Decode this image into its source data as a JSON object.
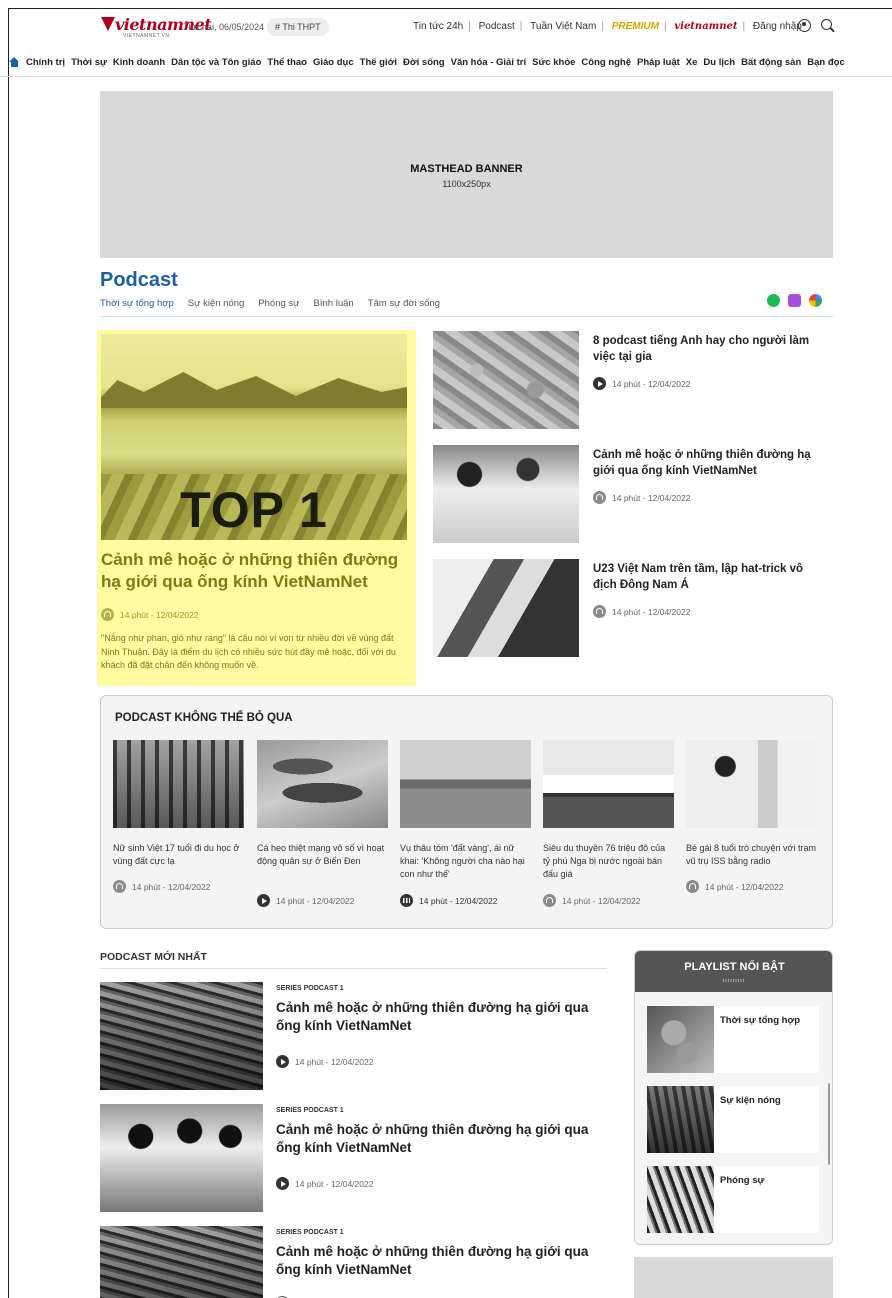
{
  "header": {
    "logo_text": "vietnamnet",
    "logo_sub": "VIETNAMNET.VN",
    "date": "Thứ hai, 06/05/2024",
    "hashtag": "# Thi THPT",
    "links": [
      "Tin tức 24h",
      "Podcast",
      "Tuần Việt Nam"
    ],
    "premium": "PREMIUM",
    "global_logo": "vietnamnet",
    "login": "Đăng nhập",
    "icons": [
      "user-icon",
      "search-icon"
    ]
  },
  "nav": {
    "home_icon": "home-icon",
    "items": [
      "Chính trị",
      "Thời sự",
      "Kinh doanh",
      "Dân tộc và Tôn giáo",
      "Thể thao",
      "Giáo dục",
      "Thế giới",
      "Đời sống",
      "Văn hóa - Giải trí",
      "Sức khỏe",
      "Công nghệ",
      "Pháp luật",
      "Xe",
      "Du lịch",
      "Bất động sản",
      "Bạn đọc"
    ]
  },
  "banner": {
    "title": "MASTHEAD BANNER",
    "size": "1100x250px"
  },
  "podcast": {
    "title": "Podcast",
    "tabs": [
      "Thời sự tổng hợp",
      "Sự kiện nóng",
      "Phóng sự",
      "Bình luận",
      "Tâm sự đời sống"
    ],
    "platforms": [
      "spotify-icon",
      "apple-podcasts-icon",
      "google-podcasts-icon"
    ]
  },
  "featured": {
    "badge": "TOP 1",
    "title": "Cảnh mê hoặc ở những thiên đường hạ giới qua ống kính VietNamNet",
    "meta": "14 phút - 12/04/2022",
    "description": "\"Nắng như phan, gió như rang\" là câu nói ví von từ nhiều đời về vùng đất Ninh Thuận. Đây là điểm du lịch có nhiều sức hút đầy mê hoặc, đối với du khách đã đặt chân đến không muốn về."
  },
  "side_items": [
    {
      "title": "8 podcast tiếng Anh hay cho người làm việc tại gia",
      "meta": "14 phút - 12/04/2022"
    },
    {
      "title": "Cảnh mê hoặc ở những thiên đường hạ giới qua ống kính VietNamNet",
      "meta": "14 phút - 12/04/2022"
    },
    {
      "title": "U23 Việt Nam trên tầm, lập hat-trick vô địch Đông Nam Á",
      "meta": "14 phút - 12/04/2022"
    }
  ],
  "must_listen": {
    "title": "PODCAST KHÔNG THỂ BỎ QUA",
    "cards": [
      {
        "title": "Nữ sinh Việt 17 tuổi đi du học ở vùng đất cực lạ",
        "meta": "14 phút - 12/04/2022"
      },
      {
        "title": "Cá heo thiệt mạng vô số vì hoạt động quân sự ở Biển Đen",
        "meta": "14 phút - 12/04/2022"
      },
      {
        "title": "Vụ thâu tóm 'đất vàng', ái nữ khai: 'Không người cha nào hại con như thế'",
        "meta": "14 phút - 12/04/2022"
      },
      {
        "title": "Siêu du thuyền 76 triệu đô của tỷ phú Nga bị nước ngoài bán đấu giá",
        "meta": "14 phút - 12/04/2022"
      },
      {
        "title": "Bé gái 8 tuổi trò chuyện với trạm vũ trụ ISS bằng radio",
        "meta": "14 phút - 12/04/2022"
      }
    ]
  },
  "latest": {
    "title": "PODCAST MỚI NHẤT",
    "items": [
      {
        "series": "SERIES PODCAST 1",
        "title": "Cảnh mê hoặc ở những thiên đường hạ giới qua ống kính VietNamNet",
        "meta": "14 phút - 12/04/2022"
      },
      {
        "series": "SERIES PODCAST 1",
        "title": "Cảnh mê hoặc ở những thiên đường hạ giới qua ống kính VietNamNet",
        "meta": "14 phút - 12/04/2022"
      },
      {
        "series": "SERIES PODCAST 1",
        "title": "Cảnh mê hoặc ở những thiên đường hạ giới qua ống kính VietNamNet",
        "meta": ""
      }
    ]
  },
  "playlist": {
    "title": "PLAYLIST NỔI BẬT",
    "items": [
      "Thời sự tổng hợp",
      "Sự kiện nóng",
      "Phóng sự"
    ]
  },
  "colors": {
    "brand_red": "#b3001b",
    "brand_blue": "#1a5fa8",
    "highlight_yellow": "#fdfca2",
    "premium_gold": "#d9a300"
  }
}
